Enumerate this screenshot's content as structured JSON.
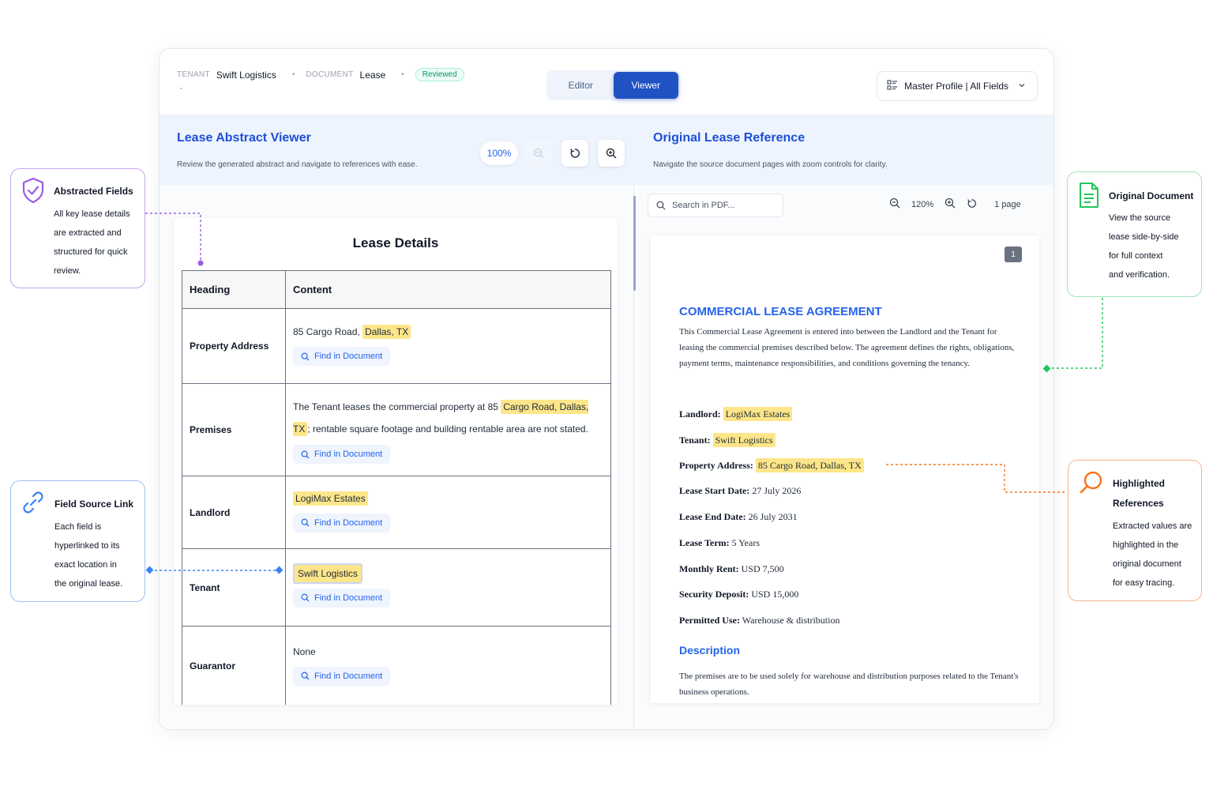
{
  "header": {
    "tenant_key": "TENANT",
    "tenant_value": "Swift Logistics",
    "document_key": "DOCUMENT",
    "document_value": "Lease",
    "status_badge": "Reviewed",
    "mode_editor": "Editor",
    "mode_viewer": "Viewer",
    "profile_label": "Master Profile | All Fields"
  },
  "left_pane": {
    "title": "Lease Abstract Viewer",
    "subtitle": "Review the generated abstract and navigate to references with ease.",
    "zoom": "100%",
    "card_title": "Lease Details",
    "col_heading": "Heading",
    "col_content": "Content",
    "find_label": "Find in Document",
    "rows": [
      {
        "heading": "Property Address",
        "text": "85 Cargo Road, ",
        "highlight": "Dallas, TX"
      },
      {
        "heading": "Premises",
        "text_before": "The Tenant leases the commercial property at 85 ",
        "highlight": "Cargo Road, Dallas, TX",
        "text_after": "; rentable square footage and building rentable area are not stated."
      },
      {
        "heading": "Landlord",
        "highlight": "LogiMax Estates"
      },
      {
        "heading": "Tenant",
        "highlight": "Swift Logistics"
      },
      {
        "heading": "Guarantor",
        "text": "None"
      }
    ]
  },
  "right_pane": {
    "title": "Original Lease Reference",
    "subtitle": "Navigate the source document pages with zoom controls for clarity.",
    "search_placeholder": "Search in PDF...",
    "zoom": "120%",
    "page_count": "1 page",
    "page_number": "1",
    "doc_title": "COMMERCIAL LEASE AGREEMENT",
    "doc_intro": "This Commercial Lease Agreement is entered into between the Landlord and the Tenant for leasing the commercial premises described below. The agreement defines the rights, obligations, payment terms, maintenance responsibilities, and conditions governing the tenancy.",
    "fields": [
      {
        "label": "Landlord:",
        "value": "LogiMax Estates",
        "highlighted": true
      },
      {
        "label": "Tenant:",
        "value": "Swift Logistics",
        "highlighted": true
      },
      {
        "label": "Property Address:",
        "value": "85 Cargo Road, Dallas, TX",
        "highlighted": true
      },
      {
        "label": "Lease Start Date:",
        "value": "27 July 2026",
        "highlighted": false
      },
      {
        "label": "Lease End Date:",
        "value": "26 July 2031",
        "highlighted": false
      },
      {
        "label": "Lease Term:",
        "value": "5 Years",
        "highlighted": false
      },
      {
        "label": "Monthly Rent:",
        "value": "USD 7,500",
        "highlighted": false
      },
      {
        "label": "Security Deposit:",
        "value": "USD 15,000",
        "highlighted": false
      },
      {
        "label": "Permitted Use:",
        "value": "Warehouse & distribution",
        "highlighted": false
      }
    ],
    "description_heading": "Description",
    "description": "The premises are to be used solely for warehouse and distribution purposes related to the Tenant's business operations."
  },
  "callouts": {
    "abstracted": {
      "title": "Abstracted Fields",
      "body": [
        "All key lease details",
        "are extracted and",
        "structured for quick",
        "review."
      ],
      "color": "#9b5de5"
    },
    "source_link": {
      "title": "Field Source Link",
      "body": [
        "Each field is",
        "hyperlinked to its",
        "exact location in",
        "the original lease."
      ],
      "color": "#3b82f6"
    },
    "original": {
      "title": "Original Document",
      "body": [
        "View the source",
        "lease side-by-side",
        "for full context",
        "and verification."
      ],
      "color": "#22c55e"
    },
    "highlighted": {
      "title": "Highlighted",
      "title2": "References",
      "body": [
        "Extracted values are",
        "highlighted in the",
        "original document",
        "for easy tracing."
      ],
      "color": "#f97316"
    }
  },
  "colors": {
    "accent": "#2152c4",
    "highlight": "#fde68a",
    "band": "#eef4fd"
  }
}
